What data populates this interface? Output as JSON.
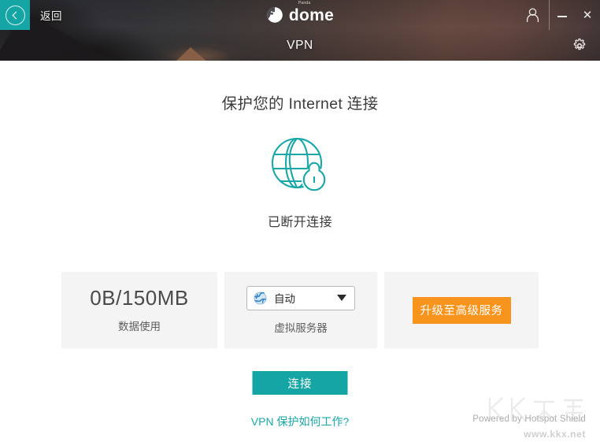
{
  "titlebar": {
    "back_label": "返回",
    "brand_sup": "Panda",
    "brand_name": "dome",
    "account_icon": "person-icon",
    "minimize_label": "",
    "close_label": "✕"
  },
  "subheader": {
    "title": "VPN",
    "settings_icon": "gear-icon"
  },
  "main": {
    "headline": "保护您的 Internet 连接",
    "hero_icon": "globe-lock-icon",
    "status": "已断开连接",
    "accent_color": "#16a5a5",
    "upgrade_color": "#f7941e"
  },
  "panels": {
    "usage": {
      "value": "0B/150MB",
      "caption": "数据使用"
    },
    "server": {
      "icon": "globe-icon",
      "selected": "自动",
      "caption": "虚拟服务器",
      "caret_icon": "chevron-down-icon"
    },
    "upgrade": {
      "button_label": "升级至高级服务"
    }
  },
  "actions": {
    "connect_label": "连接",
    "help_link": "VPN 保护如何工作?"
  },
  "footer": {
    "powered_by": "Powered by Hotspot Shield",
    "watermark_text": "KK下载",
    "watermark_url": "www.kkx.net"
  }
}
